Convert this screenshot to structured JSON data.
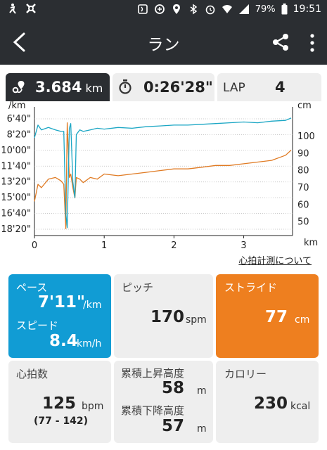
{
  "status": {
    "battery": "79%",
    "time": "19:51"
  },
  "app": {
    "title": "ラン"
  },
  "summary": {
    "distance": "3.684",
    "distance_unit": "km",
    "time": "0:26'28\"",
    "lap_label": "LAP",
    "lap_value": "4"
  },
  "chart_data": {
    "type": "line",
    "x_unit": "km",
    "left_unit": "/km",
    "right_unit": "cm",
    "x_ticks": [
      "0",
      "1",
      "2",
      "3"
    ],
    "left_ticks": [
      "6'40\"",
      "8'20\"",
      "10'00\"",
      "11'40\"",
      "13'20\"",
      "15'00\"",
      "16'40\"",
      "18'20\""
    ],
    "right_ticks": [
      "100",
      "90",
      "80",
      "70",
      "60",
      "50"
    ],
    "xlim": [
      0,
      3.7
    ],
    "pace_ylim_sec": [
      360,
      1140
    ],
    "stride_ylim": [
      42,
      114
    ],
    "colors": {
      "pace": "#1aa6c4",
      "stride": "#e07b24"
    },
    "pace_series": {
      "x": [
        0,
        0.05,
        0.1,
        0.2,
        0.3,
        0.38,
        0.42,
        0.45,
        0.47,
        0.5,
        0.52,
        0.55,
        0.58,
        0.6,
        0.65,
        0.7,
        0.8,
        0.9,
        1.0,
        1.2,
        1.4,
        1.6,
        1.8,
        2.0,
        2.2,
        2.4,
        2.6,
        2.8,
        3.0,
        3.2,
        3.4,
        3.6,
        3.68
      ],
      "y": [
        520,
        440,
        470,
        455,
        470,
        480,
        480,
        1000,
        1090,
        460,
        430,
        800,
        900,
        500,
        470,
        480,
        470,
        460,
        465,
        455,
        460,
        450,
        445,
        440,
        440,
        435,
        430,
        425,
        420,
        425,
        415,
        410,
        395
      ]
    },
    "stride_series": {
      "x": [
        0,
        0.05,
        0.1,
        0.2,
        0.3,
        0.38,
        0.42,
        0.45,
        0.47,
        0.5,
        0.52,
        0.55,
        0.58,
        0.6,
        0.65,
        0.7,
        0.8,
        0.9,
        1.0,
        1.2,
        1.4,
        1.6,
        1.8,
        2.0,
        2.2,
        2.4,
        2.6,
        2.8,
        3.0,
        3.2,
        3.4,
        3.6,
        3.68
      ],
      "y": [
        62,
        72,
        70,
        75,
        76,
        74,
        72,
        46,
        108,
        76,
        78,
        70,
        64,
        76,
        75,
        73,
        76,
        75,
        78,
        77,
        78,
        79,
        80,
        81,
        81,
        82,
        83,
        83,
        84,
        85,
        86,
        89,
        92
      ]
    }
  },
  "hr_link": "心拍計測について",
  "tiles": {
    "pace_label": "ペース",
    "pace_value": "7'11\"",
    "pace_unit": "/km",
    "speed_label": "スピード",
    "speed_value": "8.4",
    "speed_unit": "km/h",
    "pitch_label": "ピッチ",
    "pitch_value": "170",
    "pitch_unit": "spm",
    "stride_label": "ストライド",
    "stride_value": "77",
    "stride_unit": "cm",
    "hr_label": "心拍数",
    "hr_value": "125",
    "hr_unit": "bpm",
    "hr_range": "(77 - 142)",
    "ascent_label": "累積上昇高度",
    "ascent_value": "58",
    "ascent_unit": "m",
    "descent_label": "累積下降高度",
    "descent_value": "57",
    "descent_unit": "m",
    "calorie_label": "カロリー",
    "calorie_value": "230",
    "calorie_unit": "kcal"
  }
}
